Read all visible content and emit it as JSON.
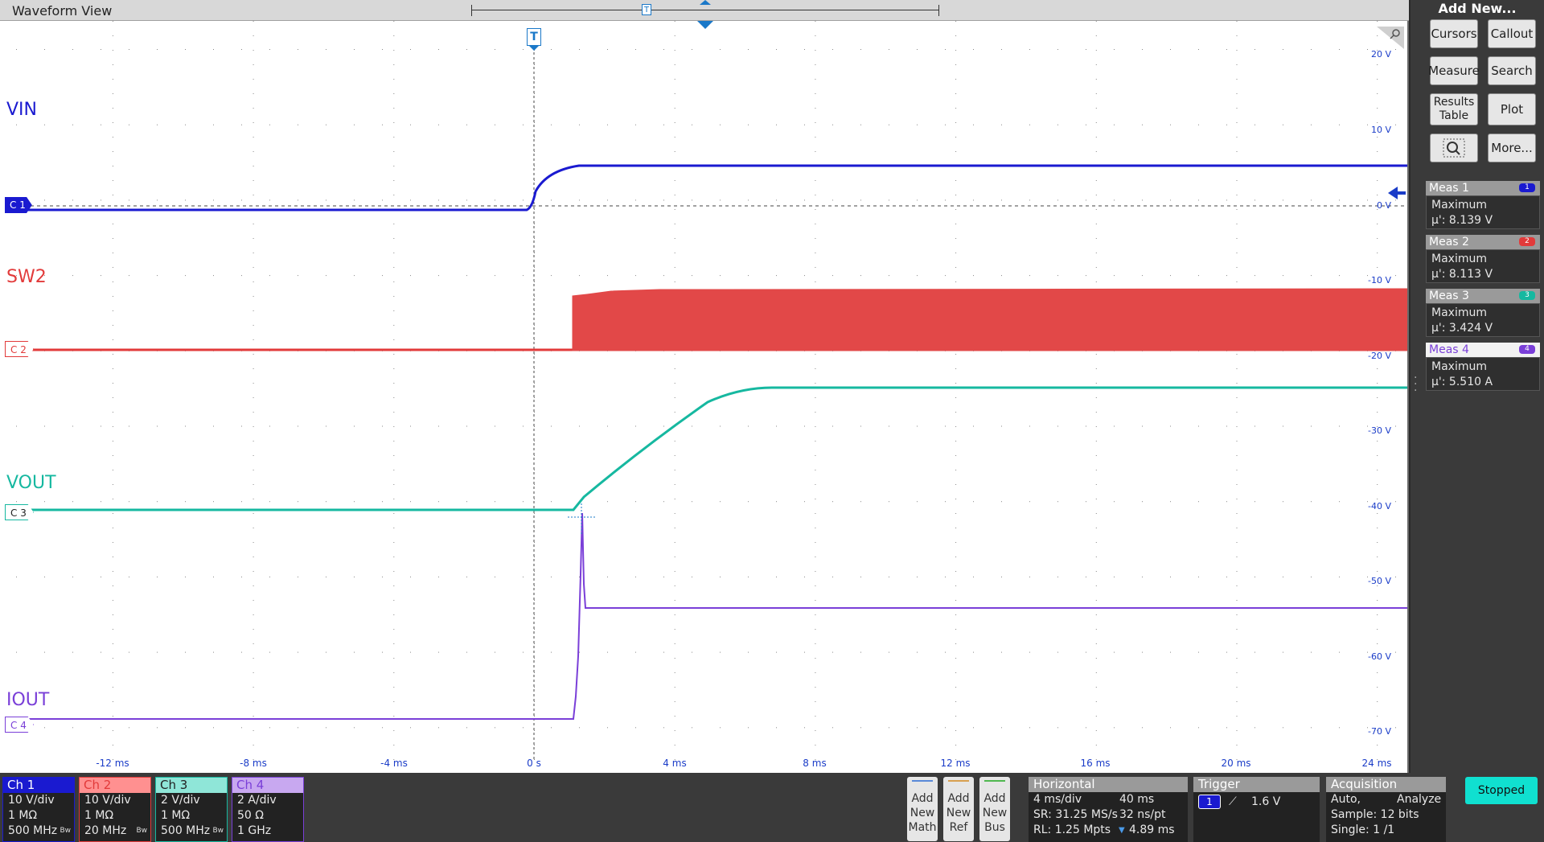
{
  "waveform_view": {
    "title": "Waveform View",
    "trigger_marker": "T",
    "trace_labels": [
      {
        "id": "vin",
        "text": "VIN",
        "color": "#1a1ad0"
      },
      {
        "id": "sw2",
        "text": "SW2",
        "color": "#e23a3a"
      },
      {
        "id": "vout",
        "text": "VOUT",
        "color": "#16b8a0"
      },
      {
        "id": "iout",
        "text": "IOUT",
        "color": "#7a3fd8"
      }
    ],
    "channel_markers": [
      "C 1",
      "C 2",
      "C 3",
      "C 4"
    ],
    "y_ticks": [
      "20 V",
      "10 V",
      "0 V",
      "-10 V",
      "-20 V",
      "-30 V",
      "-40 V",
      "-50 V",
      "-60 V",
      "-70 V"
    ],
    "x_ticks": [
      "-12 ms",
      "-8 ms",
      "-4 ms",
      "0 s",
      "4 ms",
      "8 ms",
      "12 ms",
      "16 ms",
      "20 ms",
      "24 ms"
    ]
  },
  "right_panel": {
    "title": "Add New...",
    "buttons": [
      "Cursors",
      "Callout",
      "Measure",
      "Search",
      "Results Table",
      "Plot",
      "More..."
    ],
    "measurements": [
      {
        "name": "Meas 1",
        "badge": "1",
        "type": "Maximum",
        "value": "µ': 8.139 V",
        "color": "#1a1ad0"
      },
      {
        "name": "Meas 2",
        "badge": "2",
        "type": "Maximum",
        "value": "µ': 8.113 V",
        "color": "#e23a3a"
      },
      {
        "name": "Meas 3",
        "badge": "3",
        "type": "Maximum",
        "value": "µ': 3.424 V",
        "color": "#16b8a0"
      },
      {
        "name": "Meas 4",
        "badge": "4",
        "type": "Maximum",
        "value": "µ': 5.510 A",
        "color": "#7a3fd8"
      }
    ]
  },
  "channels": [
    {
      "name": "Ch 1",
      "scale": "10 V/div",
      "impedance": "1 MΩ",
      "bandwidth": "500 MHz",
      "bw_limit": "Bw",
      "color": "#1a1ad0",
      "header_bg": "#1a1ad0",
      "header_fg": "#ffffff"
    },
    {
      "name": "Ch 2",
      "scale": "10 V/div",
      "impedance": "1 MΩ",
      "bandwidth": "20 MHz",
      "bw_limit": "Bw",
      "color": "#e23a3a",
      "header_bg": "#ff9090",
      "header_fg": "#e23a3a"
    },
    {
      "name": "Ch 3",
      "scale": "2 V/div",
      "impedance": "1 MΩ",
      "bandwidth": "500 MHz",
      "bw_limit": "Bw",
      "color": "#16b8a0",
      "header_bg": "#8fe6d8",
      "header_fg": "#222222"
    },
    {
      "name": "Ch 4",
      "scale": "2 A/div",
      "impedance": "50 Ω",
      "bandwidth": "1 GHz",
      "bw_limit": "",
      "color": "#7a3fd8",
      "header_bg": "#c8a8f0",
      "header_fg": "#7a3fd8"
    }
  ],
  "add_buttons": [
    {
      "lines": [
        "Add",
        "New",
        "Math"
      ],
      "stripe": "#5a8ad8"
    },
    {
      "lines": [
        "Add",
        "New",
        "Ref"
      ],
      "stripe": "#d8a050"
    },
    {
      "lines": [
        "Add",
        "New",
        "Bus"
      ],
      "stripe": "#50b850"
    }
  ],
  "horizontal": {
    "title": "Horizontal",
    "scale": "4 ms/div",
    "duration": "40 ms",
    "sample_rate": "SR: 31.25 MS/s",
    "resolution": "32 ns/pt",
    "record_length": "RL: 1.25 Mpts",
    "position": "4.89 ms"
  },
  "trigger": {
    "title": "Trigger",
    "source": "1",
    "level": "1.6 V"
  },
  "acquisition": {
    "title": "Acquisition",
    "mode": "Auto,",
    "analysis": "Analyze",
    "sample": "Sample: 12 bits",
    "single": "Single: 1 /1"
  },
  "run_state": "Stopped"
}
